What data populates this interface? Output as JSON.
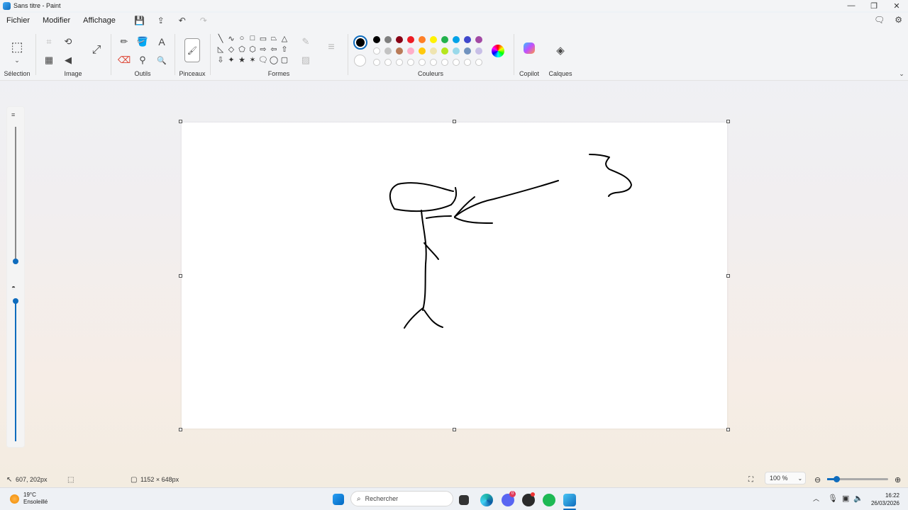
{
  "window": {
    "title": "Sans titre - Paint",
    "minimize": "—",
    "maximize": "❐",
    "close": "✕"
  },
  "menu": [
    "Fichier",
    "Modifier",
    "Affichage"
  ],
  "quick": {
    "save": "💾",
    "share": "⇪",
    "undo": "↶",
    "redo": "↷"
  },
  "right_icons": {
    "feedback": "🗨",
    "settings": "⚙"
  },
  "groups": {
    "selection": "Sélection",
    "image": "Image",
    "outils": "Outils",
    "pinceaux": "Pinceaux",
    "formes": "Formes",
    "couleurs": "Couleurs",
    "copilot": "Copilot",
    "calques": "Calques"
  },
  "icons": {
    "select": "⬚",
    "crop": "⌗",
    "rotate": "⟲",
    "resize": "⤢",
    "flip": "◀",
    "image_extra": "▦",
    "pencil": "✏",
    "fill": "🪣",
    "text": "A",
    "eraser": "⌫",
    "picker": "⚲",
    "zoom": "🔍",
    "brush": "🖌",
    "collapse": "⌄"
  },
  "shapes": [
    "╲",
    "∿",
    "○",
    "□",
    "▭",
    "⏢",
    "△",
    "◺",
    "◇",
    "⬠",
    "⬡",
    "⇨",
    "⇦",
    "⇧",
    "⇩",
    "✦",
    "★",
    "✶",
    "🗨",
    "◯",
    "▢"
  ],
  "colors": {
    "primary": "#000000",
    "secondary": "#ffffff",
    "row1": [
      "#000000",
      "#7f7f7f",
      "#880015",
      "#ed1c24",
      "#ff7f27",
      "#fff200",
      "#22b14c",
      "#00a2e8",
      "#3f48cc",
      "#a349a4"
    ],
    "row2": [
      "#ffffff",
      "#c3c3c3",
      "#b97a57",
      "#ffaec9",
      "#ffc90e",
      "#efe4b0",
      "#b5e61d",
      "#99d9ea",
      "#7092be",
      "#c8bfe7"
    ],
    "row3_count": 10
  },
  "status": {
    "cursor": "607, 202px",
    "canvas_size": "1152 × 648px",
    "zoom": "100 %",
    "zoom_minus": "⊖",
    "zoom_plus": "⊕"
  },
  "taskbar": {
    "temperature": "19°C",
    "weather": "Ensoleillé",
    "search_placeholder": "Rechercher",
    "time": "16:22",
    "date": "26/03/2026",
    "discord_badge": "0"
  }
}
